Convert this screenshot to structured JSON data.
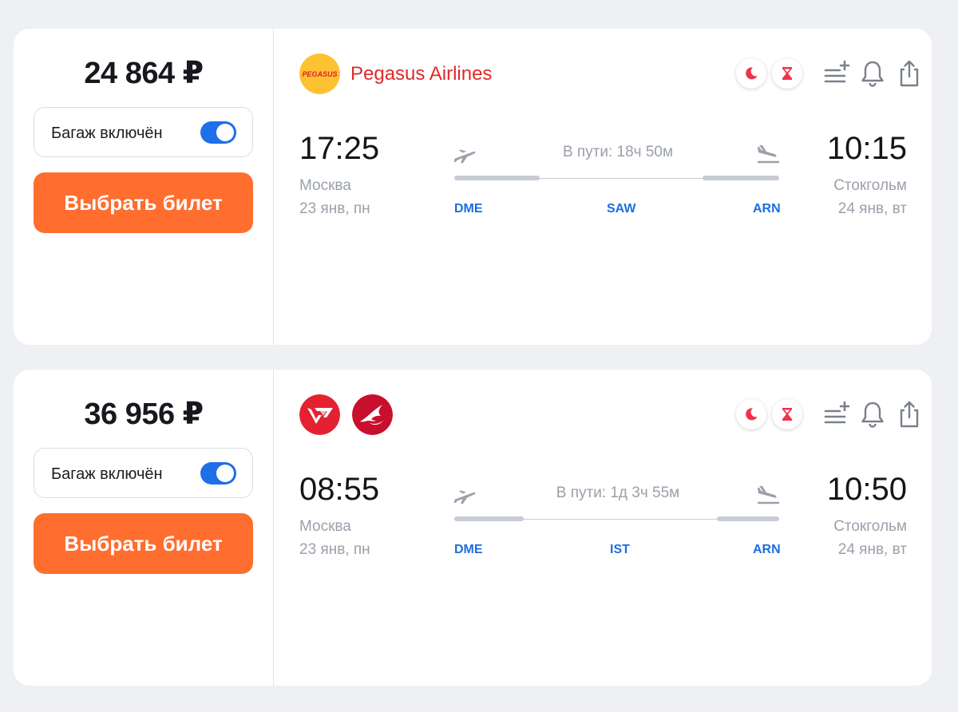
{
  "colors": {
    "accent_orange": "#ff6d2f",
    "toggle_blue": "#1e6fe8",
    "airline_red": "#e0292a",
    "iata_blue": "#1b6ee0",
    "muted_text": "#9aa0ab"
  },
  "tickets": [
    {
      "price": "24 864 ₽",
      "baggage_label": "Багаж включён",
      "baggage_enabled": true,
      "select_label": "Выбрать билет",
      "airline_logos": [
        "pegasus-logo"
      ],
      "pegasus_logo_text": "PEGASUS",
      "airline_name": "Pegasus Airlines",
      "badges": [
        "moon-icon",
        "hourglass-icon"
      ],
      "tools": [
        "add-to-list-icon",
        "bell-icon",
        "share-icon"
      ],
      "departure": {
        "time": "17:25",
        "city": "Москва",
        "date": "23 янв, пн",
        "iata": "DME"
      },
      "transfer_iata": "SAW",
      "duration": "В пути: 18ч 50м",
      "arrival": {
        "time": "10:15",
        "city": "Стокгольм",
        "date": "24 янв, вт",
        "iata": "ARN"
      }
    },
    {
      "price": "36 956 ₽",
      "baggage_label": "Багаж включён",
      "baggage_enabled": true,
      "select_label": "Выбрать билет",
      "airline_logos": [
        "red-wings-logo",
        "turkish-airlines-logo"
      ],
      "airline_name": "",
      "badges": [
        "moon-icon",
        "hourglass-icon"
      ],
      "tools": [
        "add-to-list-icon",
        "bell-icon",
        "share-icon"
      ],
      "departure": {
        "time": "08:55",
        "city": "Москва",
        "date": "23 янв, пн",
        "iata": "DME"
      },
      "transfer_iata": "IST",
      "duration": "В пути: 1д 3ч 55м",
      "arrival": {
        "time": "10:50",
        "city": "Стокгольм",
        "date": "24 янв, вт",
        "iata": "ARN"
      }
    }
  ]
}
